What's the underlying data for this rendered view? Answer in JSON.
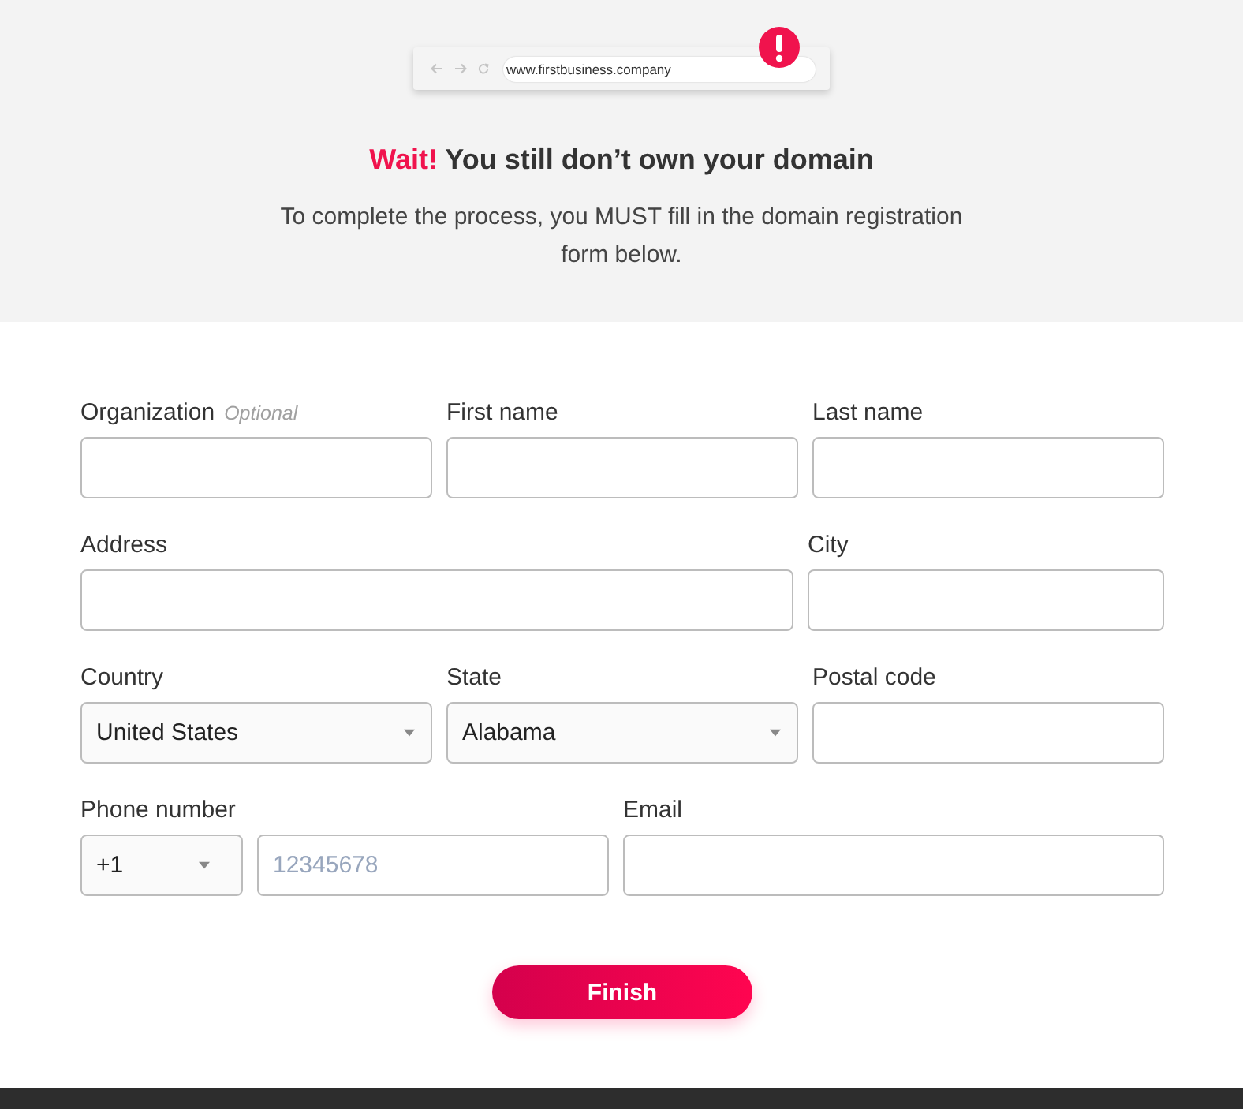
{
  "browser_mockup": {
    "url": "www.firstbusiness.company",
    "alert": true
  },
  "heading": {
    "accent": "Wait!",
    "text": "You still don’t own your domain"
  },
  "intro": "To complete the process, you MUST fill in the domain registration form below.",
  "form": {
    "rows": [
      {
        "fields": [
          {
            "kind": "text",
            "label": "Organization",
            "hint": "Optional"
          },
          {
            "kind": "text",
            "label": "First name"
          },
          {
            "kind": "text",
            "label": "Last name"
          }
        ]
      },
      {
        "fields": [
          {
            "kind": "text",
            "label": "Address"
          },
          {
            "kind": "text",
            "label": "City"
          }
        ]
      },
      {
        "fields": [
          {
            "kind": "select",
            "label": "Country",
            "value": "United States"
          },
          {
            "kind": "select",
            "label": "State",
            "value": "Alabama"
          },
          {
            "kind": "text",
            "label": "Postal code"
          }
        ]
      },
      {
        "fields": [
          {
            "kind": "phone",
            "label": "Phone number",
            "code": "+1",
            "placeholder": "12345678"
          },
          {
            "kind": "text",
            "label": "Email"
          }
        ]
      }
    ]
  },
  "submit_button": "Finish"
}
